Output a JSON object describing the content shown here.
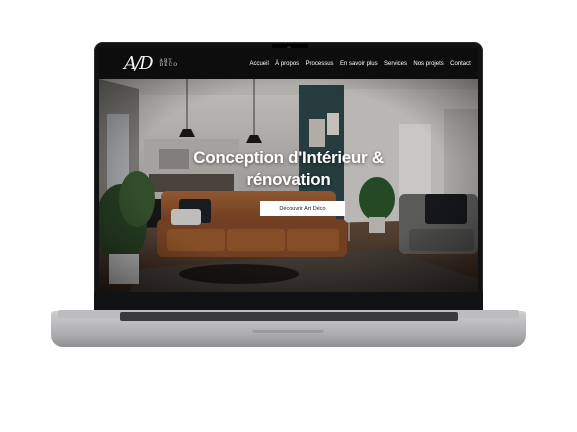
{
  "site": {
    "logo_mark": "A/D",
    "logo_line1": "ART",
    "logo_line2": "DÉCO",
    "nav": [
      {
        "label": "Accueil"
      },
      {
        "label": "À propos"
      },
      {
        "label": "Processus"
      },
      {
        "label": "En savoir plus"
      },
      {
        "label": "Services"
      },
      {
        "label": "Nos projets"
      },
      {
        "label": "Contact"
      }
    ]
  },
  "hero": {
    "title": "Conception d'Intérieur & rénovation",
    "cta_label": "Découvrir Art Déco"
  },
  "colors": {
    "nav_background": "#0d0d0d",
    "cta_background": "#ffffff",
    "wall_teal": "#2f4a4c",
    "sofa_leather": "#9a5a33"
  },
  "icons": [
    "camera-icon",
    "logo-icon"
  ]
}
